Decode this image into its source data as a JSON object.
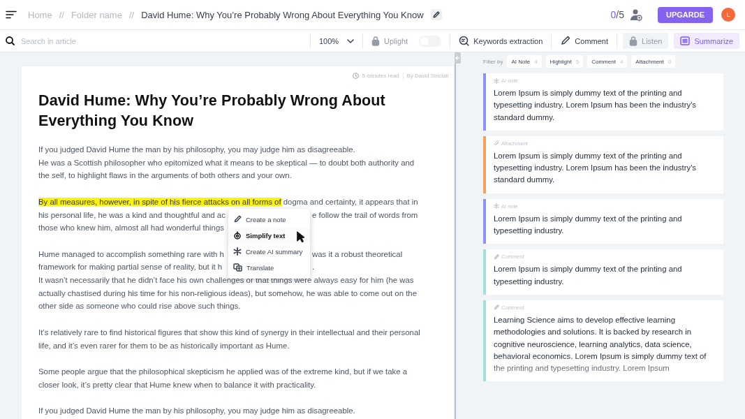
{
  "topbar": {
    "breadcrumb": [
      "Home",
      "Folder name"
    ],
    "separator": "//",
    "title": "David Hume: Why You’re Probably Wrong About Everything You Know",
    "usage_used": "0",
    "usage_total": "/5",
    "upgrade": "UPGARDE",
    "avatar": "L"
  },
  "toolbar": {
    "search_placeholder": "Search in article",
    "items": [
      {
        "kind": "zoom",
        "label": "100%",
        "disabled": false,
        "active": false
      },
      {
        "kind": "toggle",
        "label": "Uplight",
        "disabled": true,
        "active": false
      },
      {
        "kind": "keywords",
        "label": "Keywords extraction",
        "disabled": false,
        "active": false
      },
      {
        "kind": "comment",
        "label": "Comment",
        "disabled": false,
        "active": false
      },
      {
        "kind": "listen",
        "label": "Listen",
        "disabled": true,
        "active": false
      },
      {
        "kind": "summarize",
        "label": "Summarize",
        "disabled": false,
        "active": true
      }
    ]
  },
  "article": {
    "reading_time": "5 minutes read",
    "author": "By David Sinclair",
    "title": "David Hume: Why You’re Probably Wrong About Everything You Know",
    "paragraphs": [
      {
        "lines": [
          {
            "text": "If you judged David Hume the man by his philosophy, you may judge him as disagreeable."
          },
          {
            "text": "He was a Scottish philosopher who epitomized what it means to be skeptical — to doubt both authority and"
          },
          {
            "text": "the self, to highlight flaws in the arguments of both others and your own."
          }
        ]
      },
      {
        "lines": [
          {
            "highlight": "By all measures, however, in spite of his fierce attacks on all forms of",
            "text": " dogma and certainty, it appears that in"
          },
          {
            "text": "his personal life, he was a kind and thoughtful and ac",
            "after_menu": "e follow the trail of words from"
          },
          {
            "text": "those who knew him, almost all had wonderful things"
          }
        ]
      },
      {
        "lines": [
          {
            "text": "Hume managed to accomplish something rare with h",
            "after_menu": "was it a robust theoretical"
          },
          {
            "text": "framework for making partial sense of reality, but it h",
            "after_menu": "."
          },
          {
            "text": "It wasn’t necessarily that he didn’t face his own challenges or that things were always easy for him (he was"
          },
          {
            "text": "actually chastised during his time for his non-religious ideas), but somehow, he was able to come out on the"
          },
          {
            "text": "other side as someone who could rise above such things."
          }
        ]
      },
      {
        "lines": [
          {
            "text": "It’s relatively rare to find historical figures that show this kind of synergy in their intellectual and their personal"
          },
          {
            "text": "life, and it’s even rarer for them to be as historically important as Hume."
          }
        ]
      },
      {
        "lines": [
          {
            "text": "Some people argue that the philosophical skepticism he applied was of the extreme kind, but if we take a"
          },
          {
            "text": "closer look, it’s pretty clear that Hume knew when to balance it with practicality."
          }
        ]
      },
      {
        "lines": [
          {
            "text": "If you judged David Hume the man by his philosophy, you may judge him as disagreeable."
          }
        ]
      }
    ]
  },
  "context_menu": [
    {
      "kind": "note",
      "label": "Create a note",
      "selected": false
    },
    {
      "kind": "simplify",
      "label": "Simplify text",
      "selected": true
    },
    {
      "kind": "summary",
      "label": "Create AI summary",
      "selected": false
    },
    {
      "kind": "translate",
      "label": "Translate",
      "selected": false
    }
  ],
  "notes": {
    "filter_label": "Filter by",
    "filters": [
      {
        "label": "AI Note",
        "count": "4"
      },
      {
        "label": "Highlight",
        "count": "5"
      },
      {
        "label": "Comment",
        "count": "4"
      },
      {
        "label": "Attachment",
        "count": "0"
      }
    ],
    "cards": [
      {
        "kind": "ai_note",
        "label": "AI note",
        "color": "#8b93f8",
        "text": "Lorem Ipsum is simply dummy text of the printing and typesetting industry. Lorem Ipsum has been the industry's standard dummy."
      },
      {
        "kind": "attachment",
        "label": "Attachment",
        "color": "#f7a15c",
        "text": "Lorem Ipsum is simply dummy text of the printing and typesetting industry. Lorem Ipsum has been the industry's standard dummy."
      },
      {
        "kind": "ai_note",
        "label": "AI note",
        "color": "#8b93f8",
        "text": "Lorem Ipsum is simply dummy text of the printing and typesetting industry."
      },
      {
        "kind": "comment",
        "label": "Comment",
        "color": "#a3dfdf",
        "text": "Lorem Ipsum is simply dummy text of the printing and typesetting industry."
      },
      {
        "kind": "comment",
        "label": "Comment",
        "color": "#a3dfdf",
        "text": "Learning Science aims to develop effective learning methodologies and solutions. It is backed by research in cognitive neuroscience, learning analytics, data science, behavioral economics. Lorem Ipsum is simply dummy text of the printing and typesetting industry. Lorem Ipsum"
      }
    ]
  }
}
